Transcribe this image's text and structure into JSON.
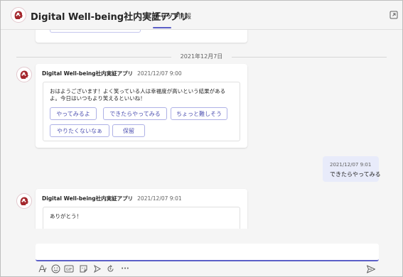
{
  "header": {
    "app_title": "Digital Well-being社内実証アプリ",
    "tabs": [
      {
        "label": "チャット",
        "active": true
      },
      {
        "label": "情報",
        "active": false
      }
    ]
  },
  "date_separator": "2021年12月7日",
  "messages": [
    {
      "sender": "Digital Well-being社内実証アプリ",
      "time": "2021/12/07 9:00",
      "text": "おはようございます！よく笑っている人は幸福度が高いという結果があるよ。今日はいつもより笑えるといいね！",
      "buttons": [
        "やってみるよ",
        "できたらやってみる",
        "ちょっと難しそう",
        "やりたくないなぁ",
        "保留"
      ]
    },
    {
      "sender": "Digital Well-being社内実証アプリ",
      "time": "2021/12/07 9:01",
      "text": "ありがとう！"
    }
  ],
  "self_message": {
    "time": "2021/12/07 9:01",
    "text": "できたらやってみる"
  },
  "colors": {
    "accent": "#5b5fc7",
    "button_text": "#4f52b2",
    "self_bubble": "#e8ebfa",
    "avatar_brand": "#a4262c"
  },
  "toolbar_icons": [
    "format-icon",
    "emoji-icon",
    "gif-icon",
    "sticker-icon",
    "schedule-meeting-icon",
    "loop-icon",
    "more-options-icon"
  ],
  "more_label": "···",
  "gif_label": "GIF"
}
